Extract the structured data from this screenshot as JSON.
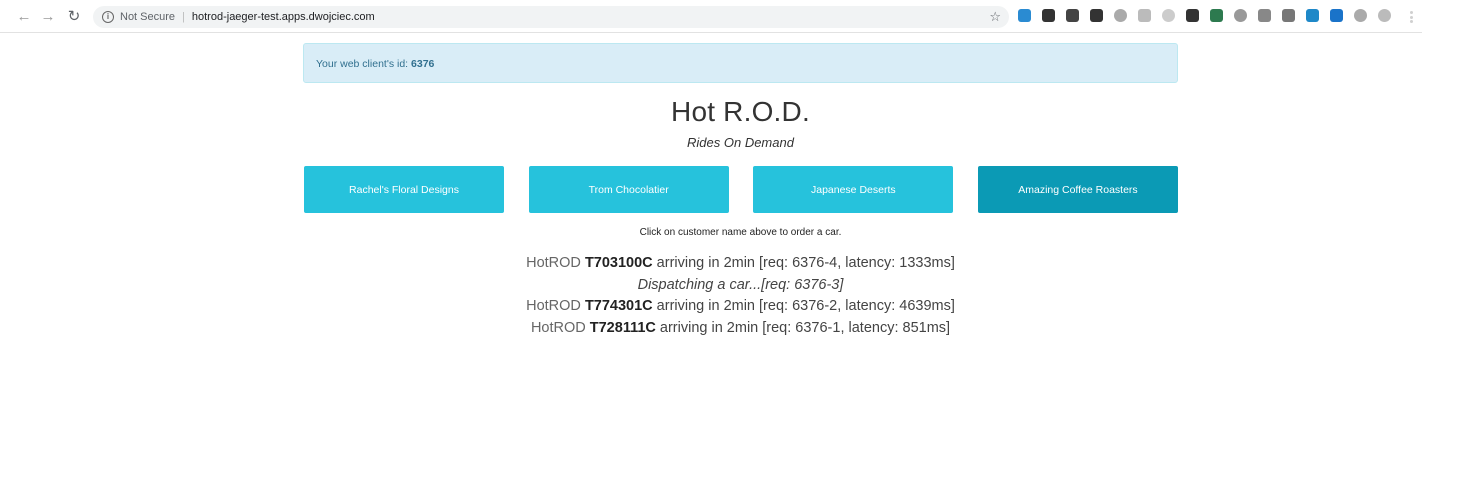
{
  "browser": {
    "security_label": "Not Secure",
    "url": "hotrod-jaeger-test.apps.dwojciec.com",
    "extensions": [
      {
        "icon": "extension-b-icon",
        "color": "#2a8bd2"
      },
      {
        "icon": "extension-fx-icon",
        "color": "#333333"
      },
      {
        "icon": "pocket-icon",
        "color": "#444444"
      },
      {
        "icon": "extension-dark-icon",
        "color": "#333333"
      },
      {
        "icon": "cloud-icon",
        "color": "#aaaaaa"
      },
      {
        "icon": "extension-grey-icon",
        "color": "#bbbbbb"
      },
      {
        "icon": "extension-outline-icon",
        "color": "#cccccc"
      },
      {
        "icon": "eyedropper-icon",
        "color": "#333333"
      },
      {
        "icon": "evernote-icon",
        "color": "#2d7a4f"
      },
      {
        "icon": "extension-circle-icon",
        "color": "#999999"
      },
      {
        "icon": "extension-gear-icon",
        "color": "#888888"
      },
      {
        "icon": "extension-grid-icon",
        "color": "#777777"
      },
      {
        "icon": "extension-blue-square-icon",
        "color": "#1e88c8"
      },
      {
        "icon": "extension-at-icon",
        "color": "#1a73c9"
      },
      {
        "icon": "extension-c-icon",
        "color": "#aaaaaa"
      },
      {
        "icon": "extension-hex-icon",
        "color": "#bbbbbb"
      }
    ]
  },
  "alert": {
    "prefix": "Your web client's id: ",
    "client_id": "6376"
  },
  "header": {
    "title": "Hot R.O.D.",
    "subtitle": "Rides On Demand"
  },
  "customers": [
    {
      "label": "Rachel's Floral Designs",
      "active": false
    },
    {
      "label": "Trom Chocolatier",
      "active": false
    },
    {
      "label": "Japanese Deserts",
      "active": false
    },
    {
      "label": "Amazing Coffee Roasters",
      "active": true
    }
  ],
  "hint": "Click on customer name above to order a car.",
  "rides": [
    {
      "brand": "HotROD ",
      "car": "T703100C",
      "detail": " arriving in 2min [req: 6376-4, latency: 1333ms]"
    },
    {
      "pending": "Dispatching a car...[req: 6376-3]"
    },
    {
      "brand": "HotROD ",
      "car": "T774301C",
      "detail": " arriving in 2min [req: 6376-2, latency: 4639ms]"
    },
    {
      "brand": "HotROD ",
      "car": "T728111C",
      "detail": " arriving in 2min [req: 6376-1, latency: 851ms]"
    }
  ],
  "colors": {
    "button": "#26c2dc",
    "button_active": "#0b9ab5",
    "alert_bg": "#d9edf7",
    "alert_text": "#31708f"
  }
}
